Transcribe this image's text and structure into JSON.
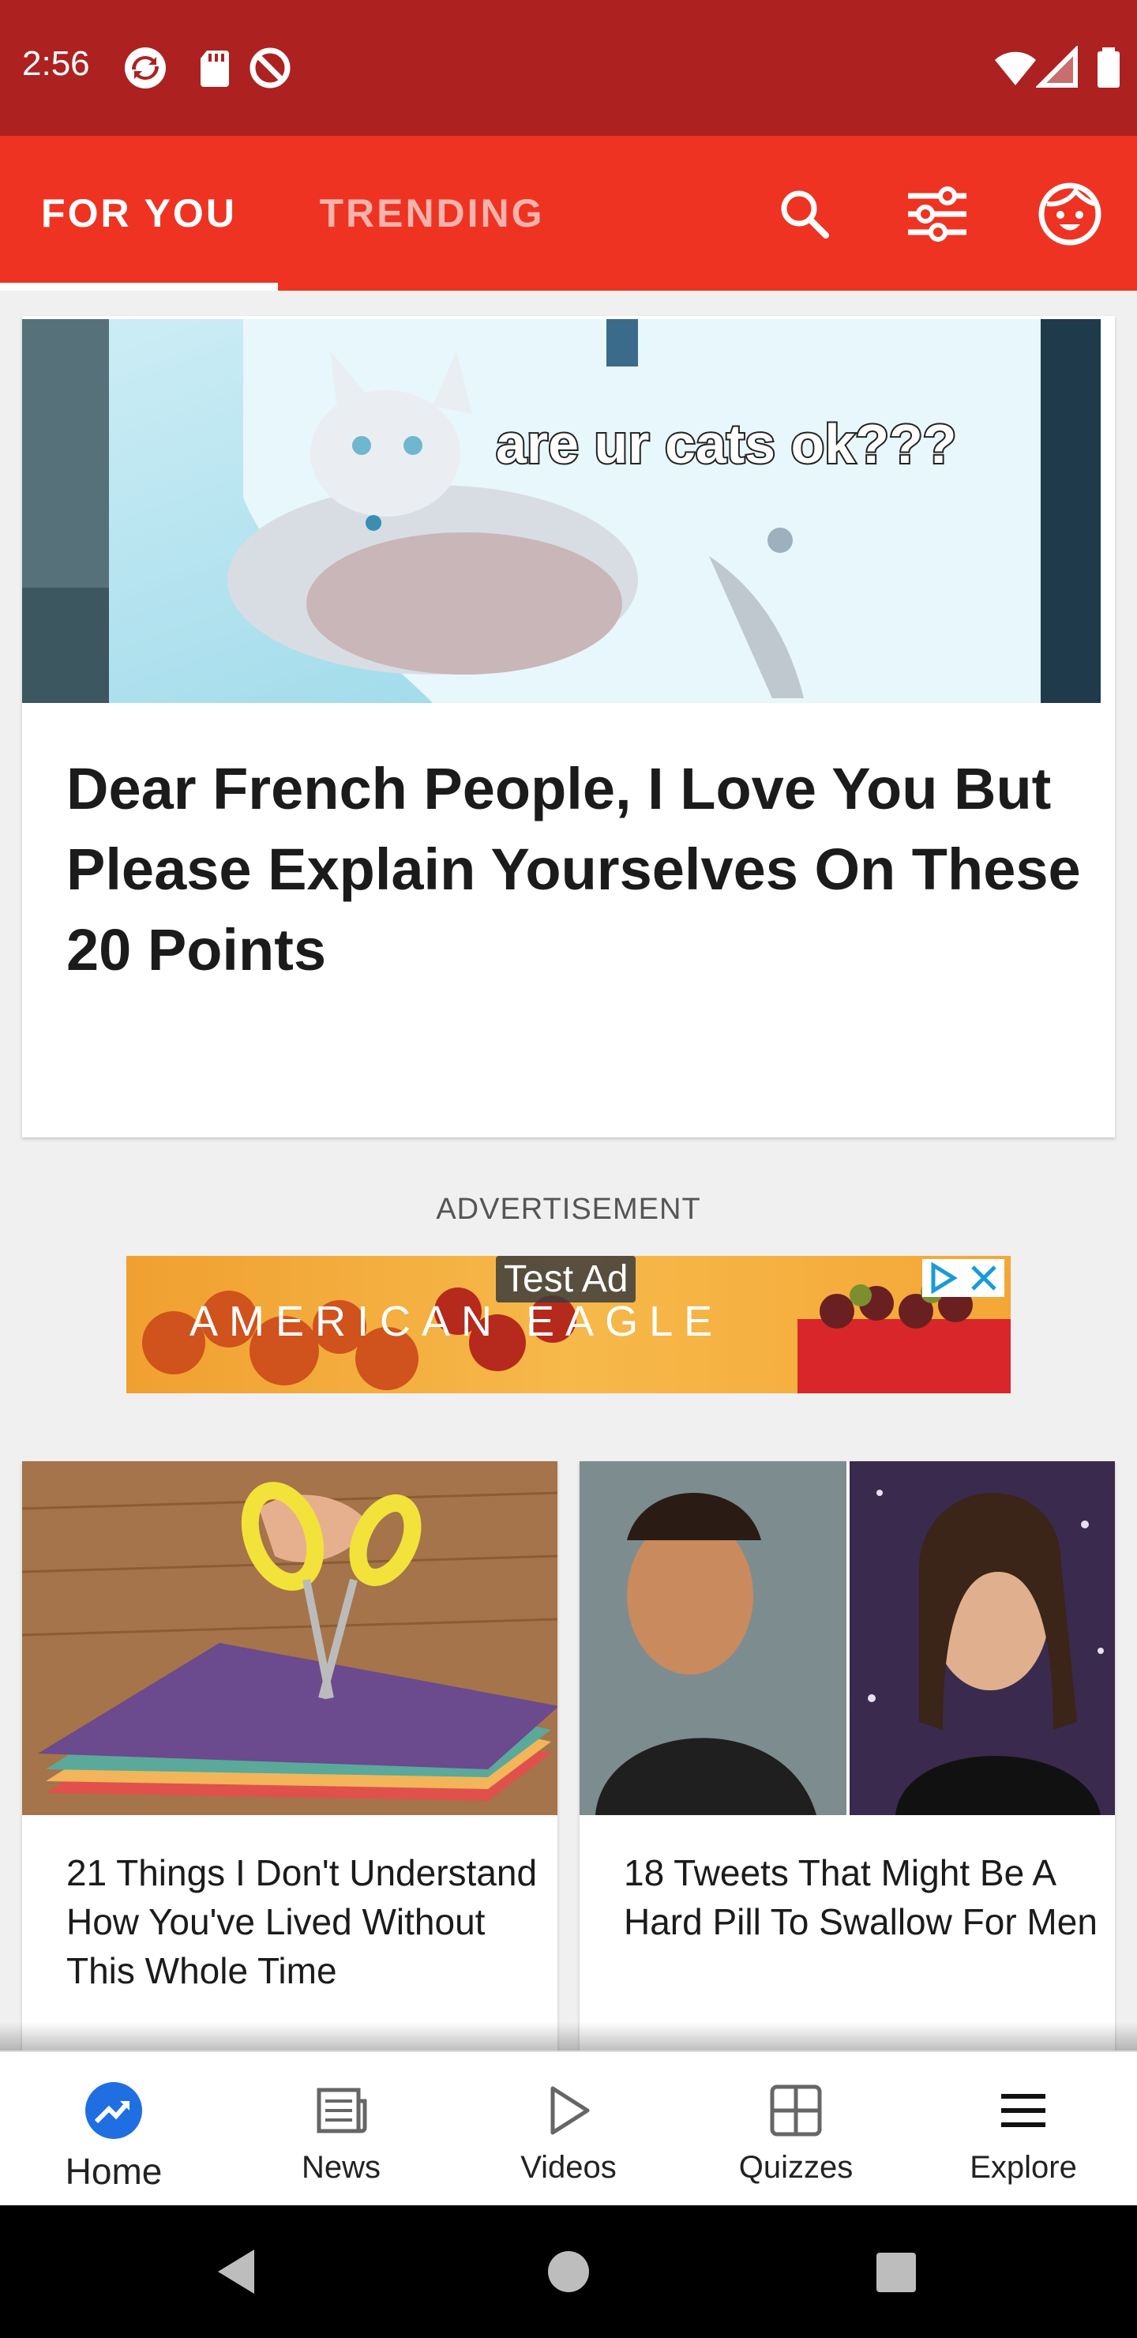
{
  "status_bar": {
    "time": "2:56",
    "icons": [
      "sync-icon",
      "sd-card-icon",
      "do-not-disturb-icon"
    ],
    "right_icons": [
      "wifi-icon",
      "cell-signal-icon",
      "battery-icon"
    ]
  },
  "app_bar": {
    "tabs": [
      {
        "label": "FOR YOU",
        "active": true
      },
      {
        "label": "TRENDING",
        "active": false
      }
    ],
    "icons": [
      "search-icon",
      "filter-sliders-icon",
      "profile-face-icon"
    ],
    "background": "#ee3322",
    "status_bar_color": "#ad2121"
  },
  "feed": {
    "hero": {
      "image_caption": "are ur cats ok???",
      "title": "Dear French People, I Love You But Please Explain Yourselves On These 20 Points"
    },
    "advertisement": {
      "label": "ADVERTISEMENT",
      "test_badge": "Test Ad",
      "brand": "AMERICAN EAGLE"
    },
    "cards": [
      {
        "title": "21 Things I Don't Understand How You've Lived Without This Whole Time"
      },
      {
        "title": "18 Tweets That Might Be A Hard Pill To Swallow For Men"
      }
    ]
  },
  "bottom_nav": {
    "items": [
      {
        "label": "Home",
        "icon": "trending-icon",
        "active": true
      },
      {
        "label": "News",
        "icon": "newspaper-icon",
        "active": false
      },
      {
        "label": "Videos",
        "icon": "play-icon",
        "active": false
      },
      {
        "label": "Quizzes",
        "icon": "grid-icon",
        "active": false
      },
      {
        "label": "Explore",
        "icon": "menu-icon",
        "active": false
      }
    ],
    "active_color": "#1f6fe3"
  }
}
